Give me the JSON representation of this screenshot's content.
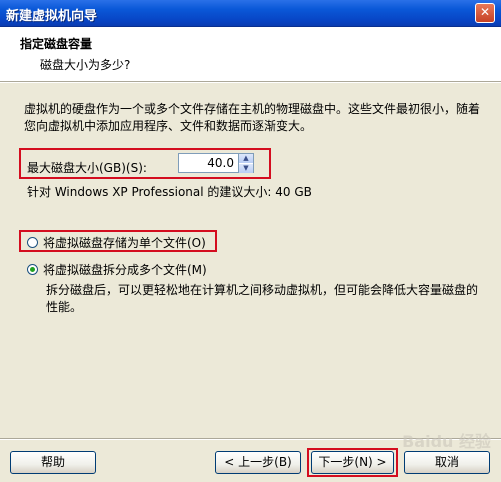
{
  "window": {
    "title": "新建虚拟机向导",
    "close_glyph": "✕"
  },
  "header": {
    "title": "指定磁盘容量",
    "subtitle": "磁盘大小为多少?"
  },
  "description": "虚拟机的硬盘作为一个或多个文件存储在主机的物理磁盘中。这些文件最初很小，随着您向虚拟机中添加应用程序、文件和数据而逐渐变大。",
  "disk_size": {
    "label": "最大磁盘大小(GB)(S):",
    "value": "40.0"
  },
  "recommended": "针对 Windows XP Professional 的建议大小: 40 GB",
  "options": [
    {
      "label": "将虚拟磁盘存储为单个文件(O)",
      "selected": false
    },
    {
      "label": "将虚拟磁盘拆分成多个文件(M)",
      "selected": true
    }
  ],
  "split_description": "拆分磁盘后，可以更轻松地在计算机之间移动虚拟机，但可能会降低大容量磁盘的性能。",
  "buttons": {
    "help": "帮助",
    "back": "< 上一步(B)",
    "next": "下一步(N) >",
    "cancel": "取消"
  },
  "watermark": "Baidu 经验",
  "colors": {
    "highlight_box": "#d40d1f",
    "title_bar": "#0a58d8",
    "radio_selected": "#21a121"
  },
  "icons": {
    "close": "close-icon",
    "spin_up": "chevron-up-icon",
    "spin_down": "chevron-down-icon"
  }
}
